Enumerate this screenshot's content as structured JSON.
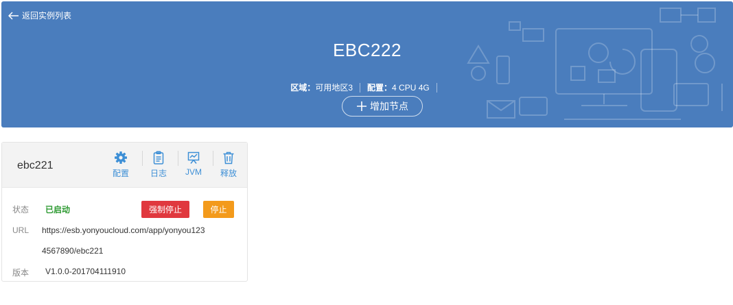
{
  "header": {
    "back_label": "返回实例列表",
    "title": "EBC222",
    "region_key": "区域：",
    "region_value": "可用地区3",
    "config_key": "配置：",
    "config_value": "4 CPU 4G",
    "add_node_label": "增加节点"
  },
  "instance": {
    "name": "ebc221",
    "tools": [
      {
        "label": "配置",
        "icon": "gear-icon"
      },
      {
        "label": "日志",
        "icon": "clipboard-icon"
      },
      {
        "label": "JVM",
        "icon": "presentation-chart-icon"
      },
      {
        "label": "释放",
        "icon": "trash-icon"
      }
    ],
    "status_label": "状态",
    "status_value": "已启动",
    "force_stop_label": "强制停止",
    "stop_label": "停止",
    "url_label": "URL",
    "url_line1": "https://esb.yonyoucloud.com/app/yonyou123",
    "url_line2": "4567890/ebc221",
    "version_label": "版本",
    "version_value": "V1.0.0-201704111910"
  },
  "colors": {
    "banner": "#4a7dbd",
    "tool_blue": "#3d8fd6",
    "status_green": "#2e9a32",
    "force_stop_red": "#e0383e",
    "stop_orange": "#f39a1b"
  }
}
